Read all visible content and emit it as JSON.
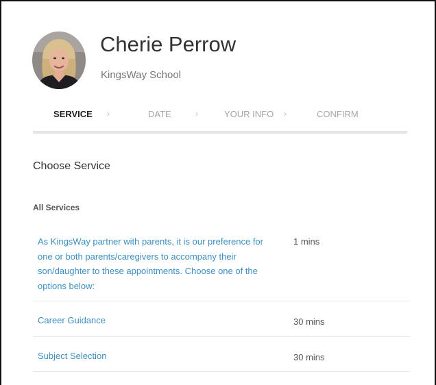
{
  "profile": {
    "name": "Cherie Perrow",
    "organization": "KingsWay School"
  },
  "steps": [
    {
      "label": "SERVICE",
      "active": true
    },
    {
      "label": "DATE",
      "active": false
    },
    {
      "label": "YOUR INFO",
      "active": false
    },
    {
      "label": "CONFIRM",
      "active": false
    }
  ],
  "step_separator": "›",
  "section_title": "Choose Service",
  "group_title": "All Services",
  "services": [
    {
      "name": "As KingsWay partner with parents, it is our preference for one or both parents/caregivers to accompany their son/daughter to these appointments. Choose one of the options below:",
      "duration": "1 mins"
    },
    {
      "name": "Career Guidance",
      "duration": "30 mins"
    },
    {
      "name": "Subject Selection",
      "duration": "30 mins"
    }
  ],
  "colors": {
    "link": "#3c8fc4",
    "active_step": "#222222",
    "inactive_step": "#a5a5a5"
  }
}
